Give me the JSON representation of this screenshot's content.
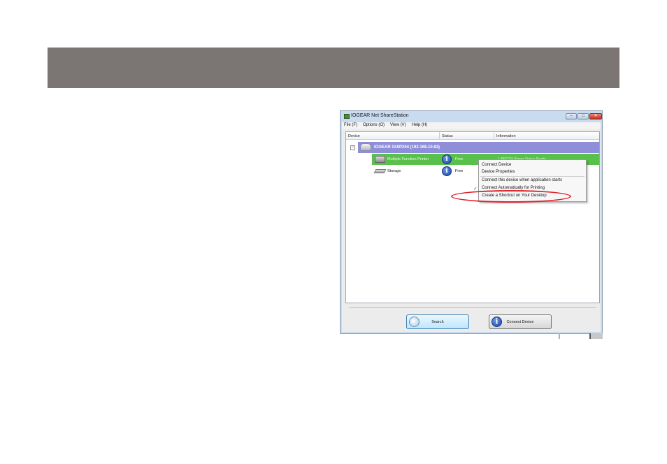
{
  "window": {
    "title": "IOGEAR Net ShareStation"
  },
  "menubar": {
    "items": [
      {
        "label": "File (F)"
      },
      {
        "label": "Options (O)"
      },
      {
        "label": "View (V)"
      },
      {
        "label": "Help (H)"
      }
    ]
  },
  "list": {
    "columns": [
      "Device",
      "Status",
      "Information"
    ],
    "gateway": {
      "label": "IOGEAR GUIP204 (192.168.10.82)"
    },
    "devices": [
      {
        "name": "Multiple Function Printer",
        "status": "Free",
        "info": "1-BROTH Power Status Ready"
      },
      {
        "name": "Storage",
        "status": "Free",
        "info": ""
      }
    ]
  },
  "context_menu": {
    "items": [
      {
        "label": "Connect Device",
        "checked": false
      },
      {
        "label": "Device Properties",
        "checked": false
      },
      {
        "label": "Connect this device when application starts",
        "checked": false
      },
      {
        "label": "Connect Automatically for Printing",
        "checked": true
      },
      {
        "label": "Create a Shortcut on Your Desktop",
        "checked": false
      }
    ],
    "check_glyph": "✓"
  },
  "buttons": {
    "search": "Search",
    "connect": "Connect Device"
  },
  "colors": {
    "banner": "#7b7574",
    "gateway_row": "#8e8fd8",
    "selected_row": "#58c04b",
    "highlight": "#e0202a"
  }
}
